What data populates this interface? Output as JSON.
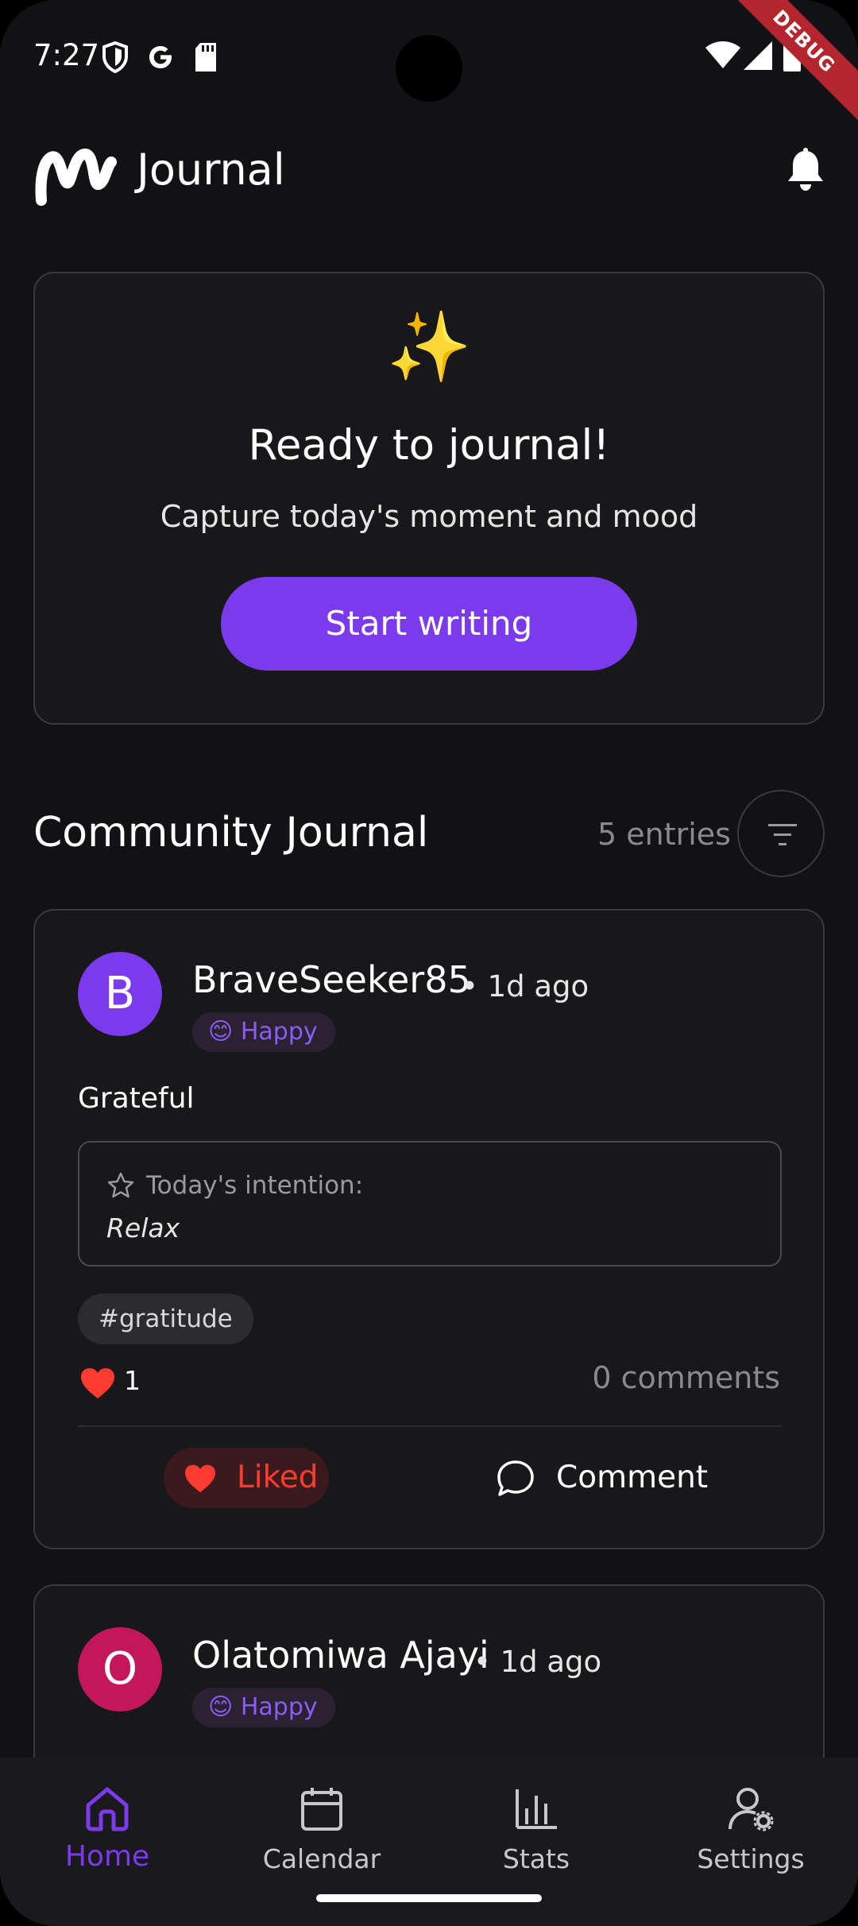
{
  "status_bar": {
    "time": "7:27",
    "debug_label": "DEBUG"
  },
  "app_bar": {
    "title": "Journal",
    "logo": "app-logo",
    "notifications_icon": "bell-icon"
  },
  "prompt_card": {
    "icon": "✨",
    "title": "Ready to journal!",
    "subtitle": "Capture today's moment and mood",
    "button_label": "Start writing"
  },
  "community": {
    "title": "Community Journal",
    "entries_count": "5 entries",
    "filter_icon": "filter-icon"
  },
  "entries": [
    {
      "avatar_letter": "B",
      "avatar_color": "#7c3aed",
      "username": "BraveSeeker85",
      "time_ago": "• 1d ago",
      "mood_emoji": "😊",
      "mood_label": "Happy",
      "title": "Grateful",
      "intention_label": "Today's intention:",
      "intention_value": "Relax",
      "tag": "#gratitude",
      "likes": "1",
      "comments": "0 comments",
      "liked_label": "Liked",
      "comment_label": "Comment"
    },
    {
      "avatar_letter": "O",
      "avatar_color": "#c2185b",
      "username": "Olatomiwa Ajayi",
      "time_ago": "• 1d ago",
      "mood_emoji": "😊",
      "mood_label": "Happy"
    }
  ],
  "bottom_nav": {
    "items": [
      {
        "label": "Home",
        "icon": "home-icon",
        "active": true
      },
      {
        "label": "Calendar",
        "icon": "calendar-icon",
        "active": false
      },
      {
        "label": "Stats",
        "icon": "stats-icon",
        "active": false
      },
      {
        "label": "Settings",
        "icon": "settings-icon",
        "active": false
      }
    ]
  },
  "colors": {
    "accent": "#7c3aed",
    "like": "#ff3b30",
    "background": "#121214",
    "card": "#18181b"
  }
}
